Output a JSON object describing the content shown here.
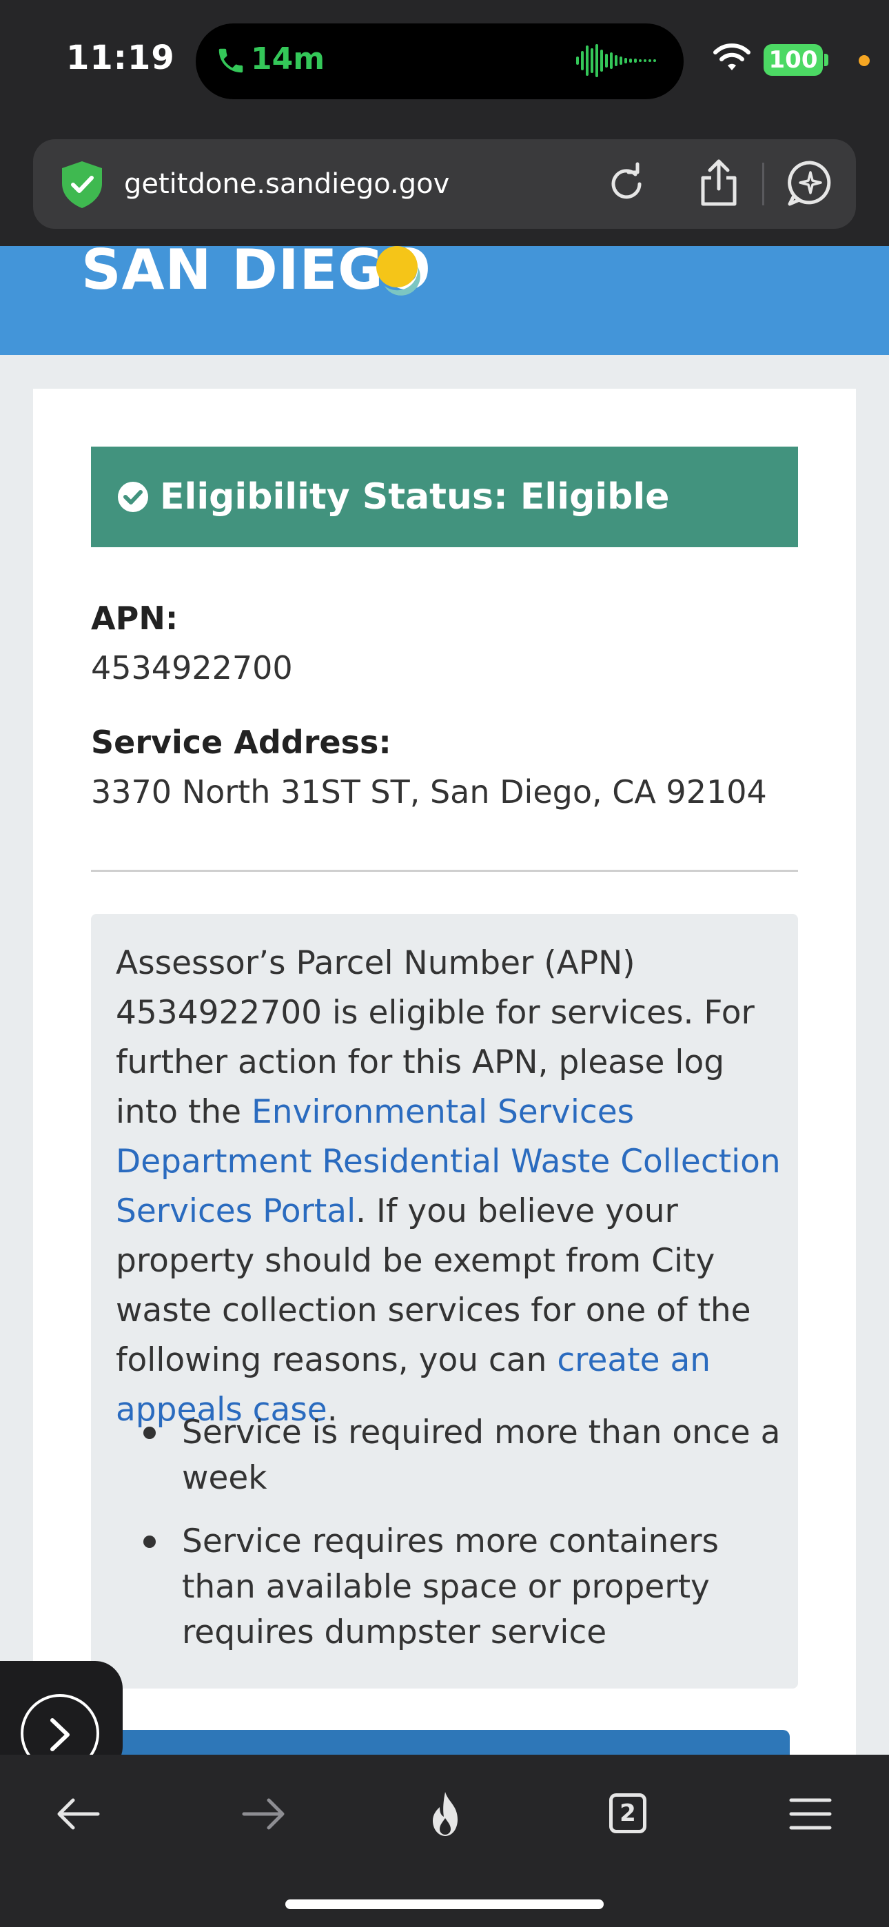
{
  "status_bar": {
    "time": "11:19",
    "call_duration": "14m",
    "battery": "100"
  },
  "browser": {
    "url": "getitdone.sandiego.gov",
    "open_tabs": "2"
  },
  "site": {
    "logo_text": "SAN DIEGO"
  },
  "eligibility": {
    "status_label": "Eligibility Status: Eligible"
  },
  "details": {
    "apn_label": "APN:",
    "apn_value": "4534922700",
    "address_label": "Service Address:",
    "address_value": "3370 North 31ST ST, San Diego, CA 92104"
  },
  "info": {
    "para_part1": "Assessor’s Parcel Number (APN) 4534922700 is eligible for services. For further action for this APN, please log into the ",
    "portal_link": "Environmental Services Department Residential Waste Collection Services Portal",
    "para_part2": ". If you believe your property should be exempt from City waste collection services for one of the following reasons, you can ",
    "appeal_link": "create an appeals case",
    "para_part3": ".",
    "bullets": [
      "Service is required more than once a week",
      "Service requires more containers than available space or property requires dumpster service"
    ]
  },
  "colors": {
    "eligible_banner": "#42937E",
    "header_blue": "#4395D9",
    "link_blue": "#2A6BBF"
  }
}
